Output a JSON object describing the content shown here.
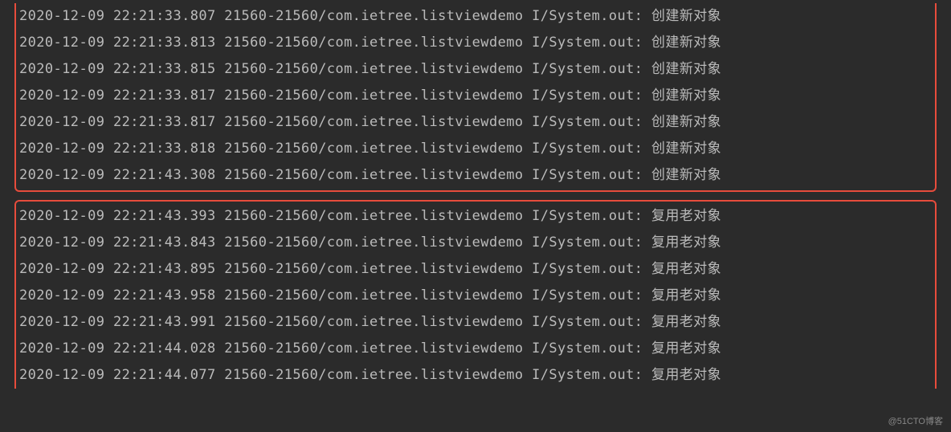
{
  "log_groups": [
    {
      "lines": [
        {
          "date": "2020-12-09",
          "time": "22:21:33.807",
          "process": "21560-21560/com.ietree.listviewdemo",
          "tag": "I/System.out:",
          "message": "创建新对象"
        },
        {
          "date": "2020-12-09",
          "time": "22:21:33.813",
          "process": "21560-21560/com.ietree.listviewdemo",
          "tag": "I/System.out:",
          "message": "创建新对象"
        },
        {
          "date": "2020-12-09",
          "time": "22:21:33.815",
          "process": "21560-21560/com.ietree.listviewdemo",
          "tag": "I/System.out:",
          "message": "创建新对象"
        },
        {
          "date": "2020-12-09",
          "time": "22:21:33.817",
          "process": "21560-21560/com.ietree.listviewdemo",
          "tag": "I/System.out:",
          "message": "创建新对象"
        },
        {
          "date": "2020-12-09",
          "time": "22:21:33.817",
          "process": "21560-21560/com.ietree.listviewdemo",
          "tag": "I/System.out:",
          "message": "创建新对象"
        },
        {
          "date": "2020-12-09",
          "time": "22:21:33.818",
          "process": "21560-21560/com.ietree.listviewdemo",
          "tag": "I/System.out:",
          "message": "创建新对象"
        },
        {
          "date": "2020-12-09",
          "time": "22:21:43.308",
          "process": "21560-21560/com.ietree.listviewdemo",
          "tag": "I/System.out:",
          "message": "创建新对象"
        }
      ]
    },
    {
      "lines": [
        {
          "date": "2020-12-09",
          "time": "22:21:43.393",
          "process": "21560-21560/com.ietree.listviewdemo",
          "tag": "I/System.out:",
          "message": "复用老对象"
        },
        {
          "date": "2020-12-09",
          "time": "22:21:43.843",
          "process": "21560-21560/com.ietree.listviewdemo",
          "tag": "I/System.out:",
          "message": "复用老对象"
        },
        {
          "date": "2020-12-09",
          "time": "22:21:43.895",
          "process": "21560-21560/com.ietree.listviewdemo",
          "tag": "I/System.out:",
          "message": "复用老对象"
        },
        {
          "date": "2020-12-09",
          "time": "22:21:43.958",
          "process": "21560-21560/com.ietree.listviewdemo",
          "tag": "I/System.out:",
          "message": "复用老对象"
        },
        {
          "date": "2020-12-09",
          "time": "22:21:43.991",
          "process": "21560-21560/com.ietree.listviewdemo",
          "tag": "I/System.out:",
          "message": "复用老对象"
        },
        {
          "date": "2020-12-09",
          "time": "22:21:44.028",
          "process": "21560-21560/com.ietree.listviewdemo",
          "tag": "I/System.out:",
          "message": "复用老对象"
        },
        {
          "date": "2020-12-09",
          "time": "22:21:44.077",
          "process": "21560-21560/com.ietree.listviewdemo",
          "tag": "I/System.out:",
          "message": "复用老对象"
        }
      ]
    }
  ],
  "watermark": "@51CTO博客"
}
